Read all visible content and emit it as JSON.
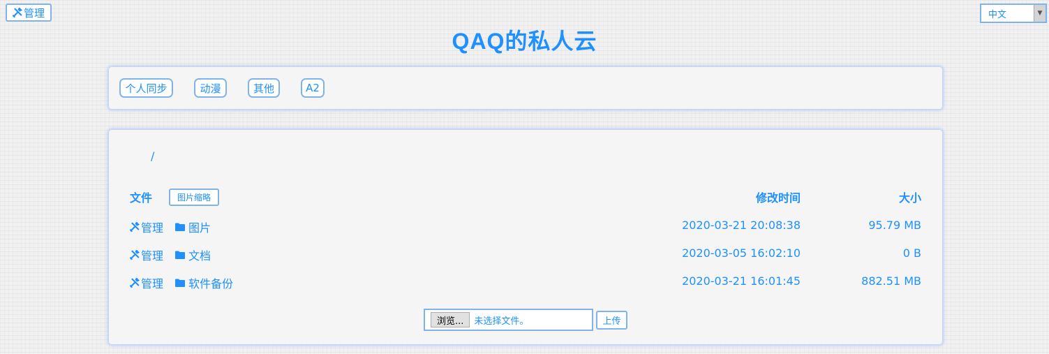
{
  "top": {
    "admin_label": "管理",
    "language": "中文"
  },
  "site_title": "QAQ的私人云",
  "nav_tags": [
    "个人同步",
    "动漫",
    "其他",
    "A2"
  ],
  "path": "/",
  "table": {
    "col_file": "文件",
    "thumb_button": "图片缩略",
    "col_modified": "修改时间",
    "col_size": "大小",
    "rows": [
      {
        "manage": "管理",
        "name": "图片",
        "modified": "2020-03-21 20:08:38",
        "size": "95.79 MB"
      },
      {
        "manage": "管理",
        "name": "文档",
        "modified": "2020-03-05 16:02:10",
        "size": "0 B"
      },
      {
        "manage": "管理",
        "name": "软件备份",
        "modified": "2020-03-21 16:01:45",
        "size": "882.51 MB"
      }
    ]
  },
  "upload": {
    "browse_label": "浏览...",
    "status": "未选择文件。",
    "submit_label": "上传"
  },
  "icons": {
    "manage": "tools-icon",
    "folder": "folder-icon",
    "dropdown": "chevron-down-icon"
  },
  "colors": {
    "accent": "#1e90ff",
    "border": "#7fb3ea"
  }
}
